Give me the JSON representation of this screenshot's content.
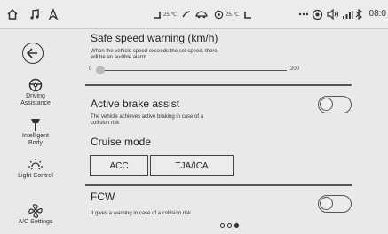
{
  "status_bar": {
    "left_icons": [
      "home-icon",
      "music-note-icon",
      "navigation-arrow-icon"
    ],
    "center_left_temp": "25.℃",
    "center_right_temp": "25.℃",
    "center_icons": [
      "seat-heat-left-icon",
      "fan-icon",
      "ac-icon",
      "seat-heat-right-icon"
    ],
    "right_icons": [
      "more-icon",
      "location-icon",
      "volume-icon",
      "signal-icon",
      "bluetooth-icon"
    ],
    "time": "08:0"
  },
  "sidebar": {
    "items": [
      {
        "icon": "steering-wheel-icon",
        "label_line1": "Driving",
        "label_line2": "Assistance"
      },
      {
        "icon": "wrench-icon",
        "label_line1": "Intelligent",
        "label_line2": "Body"
      },
      {
        "icon": "sun-icon",
        "label_line1": "Light Control",
        "label_line2": ""
      },
      {
        "icon": "fan-icon",
        "label_line1": "A/C Settings",
        "label_line2": ""
      }
    ]
  },
  "main": {
    "safe_speed": {
      "title": "Safe speed warning (km/h)",
      "desc_line1": "When the vehicle speed exceeds the set speed, there",
      "desc_line2": "will be an audible alarm",
      "min_label": "0",
      "max_label": "200",
      "value_fraction": 0.0
    },
    "active_brake": {
      "title": "Active brake assist",
      "desc_line1": "The vehicle achieves active braking in case of a",
      "desc_line2": "collision risk",
      "enabled": false
    },
    "cruise": {
      "title": "Cruise mode",
      "options": [
        "ACC",
        "TJA/ICA"
      ]
    },
    "fcw": {
      "title": "FCW",
      "desc_line1": "It gives a warning in case of a collision risk",
      "enabled": false
    },
    "page_indicator": {
      "count": 3,
      "active_index": 2
    }
  }
}
